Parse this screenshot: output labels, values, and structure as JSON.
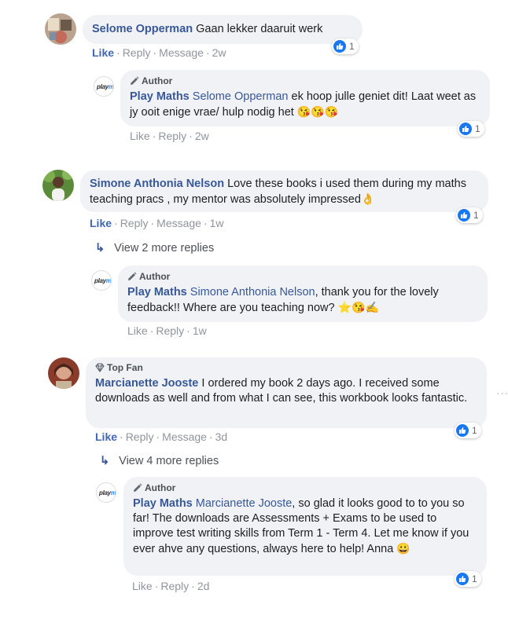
{
  "comments": [
    {
      "name": "Selome Opperman",
      "text": "Gaan lekker daaruit werk",
      "actions": {
        "like": "Like",
        "reply": "Reply",
        "message": "Message",
        "time": "2w"
      },
      "reactions": "1",
      "reply": {
        "tag": "Author",
        "name": "Play Maths",
        "mention": "Selome Opperman",
        "text": " ek hoop julle geniet dit! Laat weet as jy ooit enige vrae/ hulp nodig het",
        "emoji": "😘😘😘",
        "actions": {
          "like": "Like",
          "reply": "Reply",
          "time": "2w"
        },
        "reactions": "1"
      }
    },
    {
      "name": "Simone Anthonia Nelson",
      "text": " Love these books i used them during my maths teaching pracs , my mentor was absolutely impressed",
      "emoji": "👌",
      "actions": {
        "like": "Like",
        "reply": "Reply",
        "message": "Message",
        "time": "1w"
      },
      "reactions": "1",
      "view_more": "View 2 more replies",
      "reply": {
        "tag": "Author",
        "name": "Play Maths",
        "mention": "Simone Anthonia Nelson",
        "text": ", thank you for the lovely feedback!! Where are you teaching now?",
        "emoji": "⭐😘✍",
        "actions": {
          "like": "Like",
          "reply": "Reply",
          "time": "1w"
        }
      }
    },
    {
      "tag": "Top Fan",
      "name": "Marcianette Jooste",
      "text": " I ordered my book 2 days ago. I received some downloads as well and from what I can see, this workbook looks fantastic.",
      "actions": {
        "like": "Like",
        "reply": "Reply",
        "message": "Message",
        "time": "3d"
      },
      "reactions": "1",
      "more": "...",
      "view_more": "View 4 more replies",
      "reply": {
        "tag": "Author",
        "name": "Play Maths",
        "mention": "Marcianette Jooste",
        "text": ", so glad it looks good to to you so far! The downloads are Assessments + Exams to be used to improve test writing skills from Term 1 - Term 4. Let me know if you ever ahve any questions, always here to help! Anna",
        "emoji": "😀",
        "actions": {
          "like": "Like",
          "reply": "Reply",
          "time": "2d"
        },
        "reactions": "1"
      }
    }
  ],
  "page_logo": {
    "part1": "play",
    "part2": "m"
  },
  "colors": {
    "link": "#385898",
    "like_blue": "#4267b2",
    "bubble": "#f0f2f5",
    "reaction": "#1877f2"
  }
}
